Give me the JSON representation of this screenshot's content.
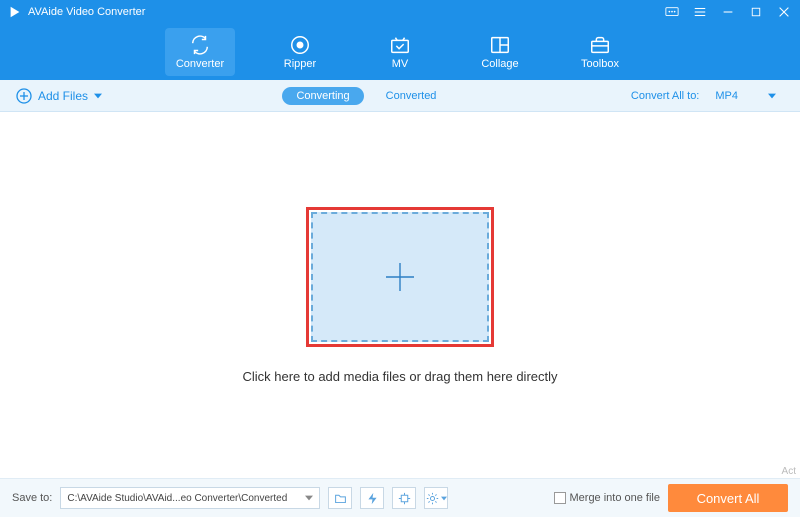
{
  "titlebar": {
    "appName": "AVAide Video Converter"
  },
  "nav": {
    "items": [
      {
        "label": "Converter"
      },
      {
        "label": "Ripper"
      },
      {
        "label": "MV"
      },
      {
        "label": "Collage"
      },
      {
        "label": "Toolbox"
      }
    ]
  },
  "toolbar": {
    "addFiles": "Add Files",
    "tabConverting": "Converting",
    "tabConverted": "Converted",
    "convertAllToLabel": "Convert All to:",
    "formatValue": "MP4"
  },
  "main": {
    "hint": "Click here to add media files or drag them here directly"
  },
  "footer": {
    "saveToLabel": "Save to:",
    "savePath": "C:\\AVAide Studio\\AVAid...eo Converter\\Converted",
    "mergeLabel": "Merge into one file",
    "convertLabel": "Convert All"
  },
  "watermark": "Act"
}
